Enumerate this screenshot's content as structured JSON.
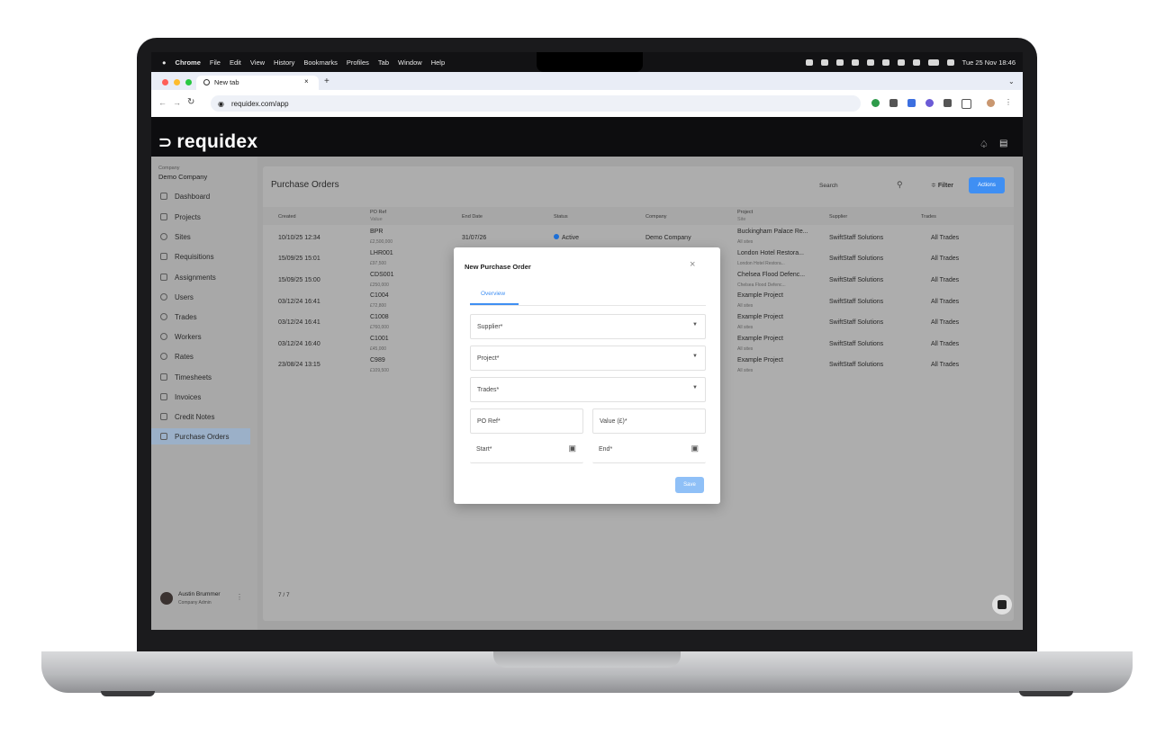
{
  "menubar": {
    "app": "Chrome",
    "items": [
      "File",
      "Edit",
      "View",
      "History",
      "Bookmarks",
      "Profiles",
      "Tab",
      "Window",
      "Help"
    ],
    "clock": "Tue 25 Nov  18:46"
  },
  "browser": {
    "tab_title": "New tab",
    "new_tab": "+",
    "url": "requidex.com/app"
  },
  "app": {
    "logo": "requidex",
    "company_label": "Company",
    "company_name": "Demo Company",
    "nav": [
      {
        "label": "Dashboard",
        "icon": "dashboard-icon"
      },
      {
        "label": "Projects",
        "icon": "projects-icon"
      },
      {
        "label": "Sites",
        "icon": "sites-icon"
      },
      {
        "label": "Requisitions",
        "icon": "requisitions-icon"
      },
      {
        "label": "Assignments",
        "icon": "assignments-icon"
      },
      {
        "label": "Users",
        "icon": "users-icon"
      },
      {
        "label": "Trades",
        "icon": "trades-icon"
      },
      {
        "label": "Workers",
        "icon": "workers-icon"
      },
      {
        "label": "Rates",
        "icon": "rates-icon"
      },
      {
        "label": "Timesheets",
        "icon": "timesheets-icon"
      },
      {
        "label": "Invoices",
        "icon": "invoices-icon"
      },
      {
        "label": "Credit Notes",
        "icon": "credit-notes-icon"
      },
      {
        "label": "Purchase Orders",
        "icon": "purchase-orders-icon"
      }
    ],
    "user": {
      "name": "Austin Brummer",
      "role": "Company Admin"
    }
  },
  "page": {
    "title": "Purchase Orders",
    "search_placeholder": "Search",
    "filter_label": "Filter",
    "actions_label": "Actions",
    "pagination": "7 / 7",
    "columns": {
      "created": "Created",
      "po_ref": "PO Ref",
      "value": "Value",
      "end_date": "End Date",
      "status": "Status",
      "company": "Company",
      "project": "Project",
      "site": "Site",
      "supplier": "Supplier",
      "trades": "Trades"
    },
    "rows": [
      {
        "created": "10/10/25 12:34",
        "ref": "BPR",
        "value": "£2,500,000",
        "end": "31/07/26",
        "status": "Active",
        "company": "Demo Company",
        "project": "Buckingham Palace Re...",
        "site": "All sites",
        "supplier": "SwiftStaff Solutions",
        "trades": "All Trades"
      },
      {
        "created": "15/09/25 15:01",
        "ref": "LHR001",
        "value": "£97,500",
        "end": "",
        "status": "",
        "company": "",
        "project": "London Hotel Restora...",
        "site": "London Hotel Restora...",
        "supplier": "SwiftStaff Solutions",
        "trades": "All Trades"
      },
      {
        "created": "15/09/25 15:00",
        "ref": "CDS001",
        "value": "£250,000",
        "end": "",
        "status": "",
        "company": "",
        "project": "Chelsea Flood Defenc...",
        "site": "Chelsea Flood Defenc...",
        "supplier": "SwiftStaff Solutions",
        "trades": "All Trades"
      },
      {
        "created": "03/12/24 16:41",
        "ref": "C1004",
        "value": "£72,800",
        "end": "",
        "status": "",
        "company": "",
        "project": "Example Project",
        "site": "All sites",
        "supplier": "SwiftStaff Solutions",
        "trades": "All Trades"
      },
      {
        "created": "03/12/24 16:41",
        "ref": "C1008",
        "value": "£760,000",
        "end": "",
        "status": "",
        "company": "",
        "project": "Example Project",
        "site": "All sites",
        "supplier": "SwiftStaff Solutions",
        "trades": "All Trades"
      },
      {
        "created": "03/12/24 16:40",
        "ref": "C1001",
        "value": "£45,000",
        "end": "",
        "status": "",
        "company": "",
        "project": "Example Project",
        "site": "All sites",
        "supplier": "SwiftStaff Solutions",
        "trades": "All Trades"
      },
      {
        "created": "23/08/24 13:15",
        "ref": "C989",
        "value": "£109,500",
        "end": "",
        "status": "",
        "company": "",
        "project": "Example Project",
        "site": "All sites",
        "supplier": "SwiftStaff Solutions",
        "trades": "All Trades"
      }
    ]
  },
  "modal": {
    "title": "New Purchase Order",
    "tab": "Overview",
    "supplier": "Supplier*",
    "project": "Project*",
    "trades": "Trades*",
    "po_ref": "PO Ref*",
    "value": "Value (£)*",
    "start": "Start*",
    "end": "End*",
    "save": "Save"
  },
  "colors": {
    "accent": "#3f8ff3",
    "save_button": "#8fc0f7",
    "status_dot": "#1d6fd6"
  }
}
